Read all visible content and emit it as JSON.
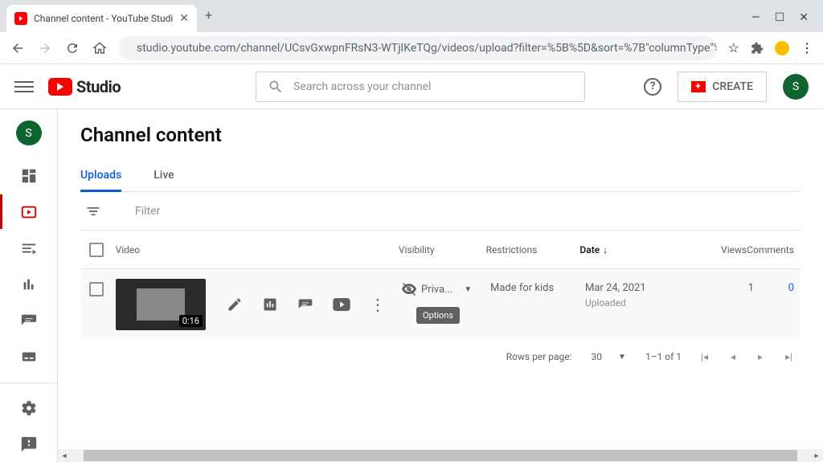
{
  "browser": {
    "tab_title": "Channel content - YouTube Studi",
    "url": "studio.youtube.com/channel/UCsvGxwpnFRsN3-WTjIKeTQg/videos/upload?filter=%5B%5D&sort=%7B\"columnType\"%3A\"..."
  },
  "header": {
    "logo_text": "Studio",
    "search_placeholder": "Search across your channel",
    "create_label": "CREATE",
    "avatar_initial": "S"
  },
  "page": {
    "title": "Channel content",
    "tabs": {
      "uploads": "Uploads",
      "live": "Live"
    },
    "filter_label": "Filter"
  },
  "columns": {
    "video": "Video",
    "visibility": "Visibility",
    "restrictions": "Restrictions",
    "date": "Date",
    "views": "Views",
    "comments": "Comments"
  },
  "rows": [
    {
      "duration": "0:16",
      "visibility": "Priva...",
      "restrictions": "Made for kids",
      "date": "Mar 24, 2021",
      "date_status": "Uploaded",
      "views": "1",
      "comments": "0"
    }
  ],
  "tooltip": "Options",
  "pagination": {
    "rows_label": "Rows per page:",
    "rows_value": "30",
    "range": "1–1 of 1"
  }
}
